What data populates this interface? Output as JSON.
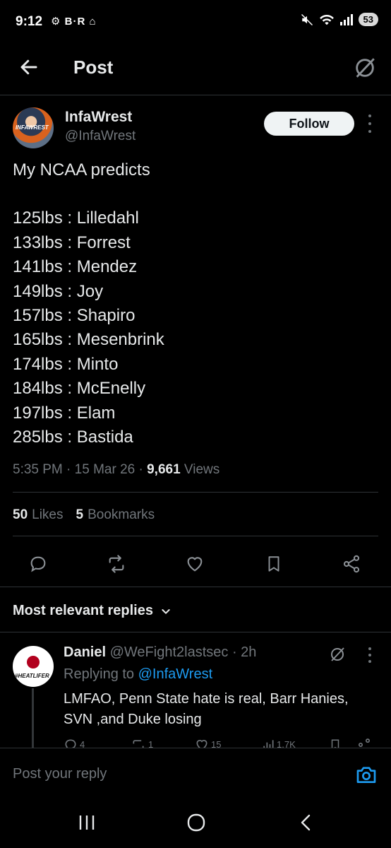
{
  "status_bar": {
    "time": "9:12",
    "app_icons": "⚙ B·R ⌂",
    "battery": "53"
  },
  "header": {
    "title": "Post"
  },
  "post": {
    "author_name": "InfaWrest",
    "author_handle": "@InfaWrest",
    "avatar_text": "INFAWREST",
    "follow_label": "Follow",
    "intro": "My NCAA predicts",
    "lines": [
      "125lbs : Lilledahl",
      "133lbs : Forrest",
      "141lbs : Mendez",
      "149lbs : Joy",
      "157lbs : Shapiro",
      "165lbs : Mesenbrink",
      "174lbs : Minto",
      "184lbs : McEnelly",
      "197lbs : Elam",
      "285lbs : Bastida"
    ],
    "time": "5:35 PM",
    "date": "15 Mar 26",
    "views_count": "9,661",
    "views_label": "Views",
    "likes_count": "50",
    "likes_label": "Likes",
    "bookmarks_count": "5",
    "bookmarks_label": "Bookmarks"
  },
  "replies_section": {
    "label": "Most relevant replies"
  },
  "reply": {
    "name": "Daniel",
    "handle": "@WeFight2lastsec",
    "time": "2h",
    "avatar_text": "#HEATLIFER",
    "replying_prefix": "Replying to",
    "replying_handle": "@InfaWrest",
    "text": "LMFAO,  Penn State hate is real, Barr Hanies, SVN ,and Duke losing",
    "reply_count": "4",
    "repost_count": "1",
    "like_count": "15",
    "views_count": "1.7K"
  },
  "composer": {
    "placeholder": "Post your reply"
  },
  "colors": {
    "background": "#000000",
    "text": "#e7e9ea",
    "muted": "#71767b",
    "accent": "#1d9bf0"
  }
}
